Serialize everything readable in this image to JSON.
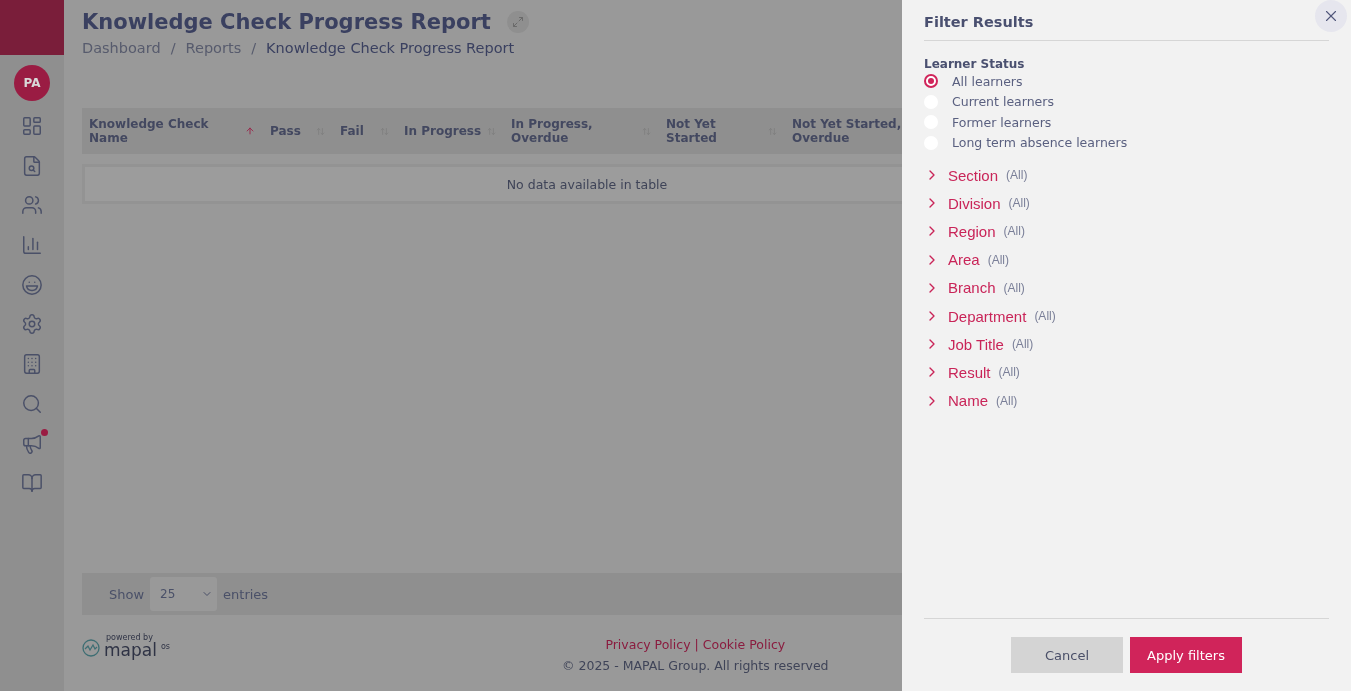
{
  "sidebar": {
    "avatar": "PA",
    "items": [
      {
        "kind": "dashboard",
        "notification": false
      },
      {
        "kind": "document-search",
        "notification": false
      },
      {
        "kind": "people",
        "notification": false
      },
      {
        "kind": "chart",
        "notification": false
      },
      {
        "kind": "smiley",
        "notification": false
      },
      {
        "kind": "settings",
        "notification": false
      },
      {
        "kind": "building",
        "notification": false
      },
      {
        "kind": "search",
        "notification": false
      },
      {
        "kind": "megaphone",
        "notification": true
      },
      {
        "kind": "info",
        "notification": false
      }
    ]
  },
  "page": {
    "title": "Knowledge Check Progress Report",
    "breadcrumb_separator": "/",
    "breadcrumbs": [
      {
        "label": "Dashboard",
        "current": false
      },
      {
        "label": "Reports",
        "current": false
      },
      {
        "label": "Knowledge Check Progress Report",
        "current": true
      }
    ],
    "table": {
      "columns": [
        {
          "label": "Knowledge Check Name",
          "sorted": true
        },
        {
          "label": "Pass",
          "sorted": false
        },
        {
          "label": "Fail",
          "sorted": false
        },
        {
          "label": "In Progress",
          "sorted": false
        },
        {
          "label": "In Progress, Overdue",
          "sorted": false
        },
        {
          "label": "Not Yet Started",
          "sorted": false
        },
        {
          "label": "Not Yet Started, Overdue"
        }
      ],
      "empty_message": "No data available in table"
    },
    "length": {
      "label_before": "Show",
      "value": "25",
      "label_after": "entries"
    }
  },
  "footer": {
    "logo": {
      "tagline": "powered by",
      "name": "mapal",
      "suffix": "os"
    },
    "links": [
      "Privacy Policy",
      "Cookie Policy"
    ],
    "separator": "|",
    "copyright": "© 2025 - MAPAL Group. All rights reserved"
  },
  "filter_panel": {
    "title": "Filter Results",
    "learner_status": {
      "label": "Learner Status",
      "options": [
        {
          "label": "All learners",
          "selected": true
        },
        {
          "label": "Current learners",
          "selected": false
        },
        {
          "label": "Former learners",
          "selected": false
        },
        {
          "label": "Long term absence learners",
          "selected": false
        }
      ]
    },
    "filters": [
      {
        "label": "Section",
        "value": "(All)",
        "expanded": false
      },
      {
        "label": "Division",
        "value": "(All)",
        "expanded": false
      },
      {
        "label": "Region",
        "value": "(All)",
        "expanded": false
      },
      {
        "label": "Area",
        "value": "(All)",
        "expanded": false
      },
      {
        "label": "Branch",
        "value": "(All)",
        "expanded": false
      },
      {
        "label": "Department",
        "value": "(All)",
        "expanded": false
      },
      {
        "label": "Job Title",
        "value": "(All)",
        "expanded": false
      },
      {
        "label": "Result",
        "value": "(All)",
        "expanded": false
      },
      {
        "label": "Name",
        "value": "(All)",
        "expanded": false
      }
    ],
    "buttons": {
      "cancel": "Cancel",
      "apply": "Apply filters"
    }
  }
}
